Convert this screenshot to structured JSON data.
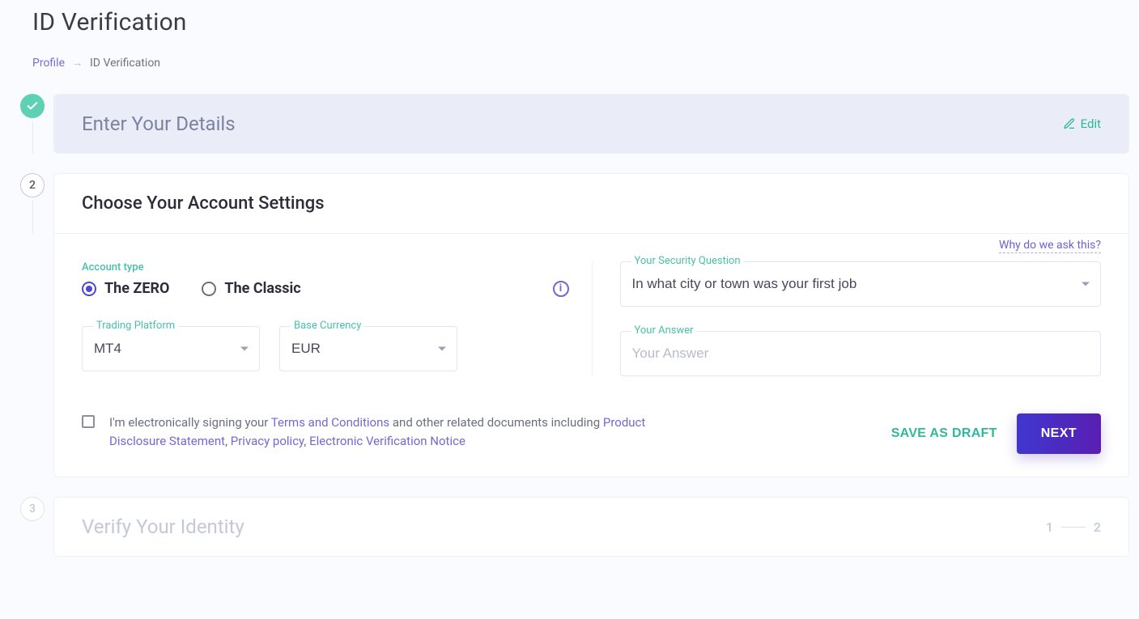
{
  "page_title": "ID Verification",
  "breadcrumb": {
    "parent": "Profile",
    "current": "ID Verification"
  },
  "steps": {
    "s2_number": "2",
    "s3_number": "3",
    "enter_details": {
      "title": "Enter Your Details",
      "edit_label": "Edit"
    },
    "account_settings": {
      "title": "Choose Your Account Settings",
      "account_type_label": "Account type",
      "options": {
        "zero": "The ZERO",
        "classic": "The Classic"
      },
      "trading_platform": {
        "label": "Trading Platform",
        "value": "MT4"
      },
      "base_currency": {
        "label": "Base Currency",
        "value": "EUR"
      },
      "why": "Why do we ask this?",
      "security_q": {
        "label": "Your Security Question",
        "value": "In what city or town was your first job"
      },
      "answer": {
        "label": "Your Answer",
        "placeholder": "Your Answer"
      },
      "consent": {
        "pre_terms": "I'm electronically signing your ",
        "terms": "Terms and Conditions",
        "mid": " and other related documents including ",
        "pds": "Product Disclosure Statement",
        "comma": ", ",
        "privacy": "Privacy policy",
        "comma2": ", ",
        "evn": "Electronic Verification Notice"
      },
      "buttons": {
        "draft": "SAVE AS DRAFT",
        "next": "NEXT"
      }
    },
    "verify": {
      "title": "Verify Your Identity",
      "sub1": "1",
      "sub2": "2"
    }
  }
}
